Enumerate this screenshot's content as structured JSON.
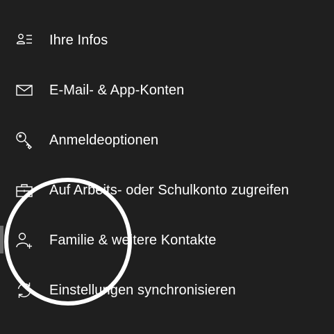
{
  "nav": {
    "items": [
      {
        "label": "Ihre Infos",
        "icon": "person-list-icon"
      },
      {
        "label": "E-Mail- & App-Konten",
        "icon": "mail-icon"
      },
      {
        "label": "Anmeldeoptionen",
        "icon": "key-icon"
      },
      {
        "label": "Auf Arbeits- oder Schulkonto zugreifen",
        "icon": "briefcase-icon"
      },
      {
        "label": "Familie & weitere Kontakte",
        "icon": "person-add-icon"
      },
      {
        "label": "Einstellungen synchronisieren",
        "icon": "sync-icon"
      }
    ],
    "selected_index": 4
  },
  "colors": {
    "background": "#1f1f1f",
    "text": "#ffffff",
    "selected_marker": "#6b6b6b",
    "highlight_ring": "#ffffff"
  }
}
